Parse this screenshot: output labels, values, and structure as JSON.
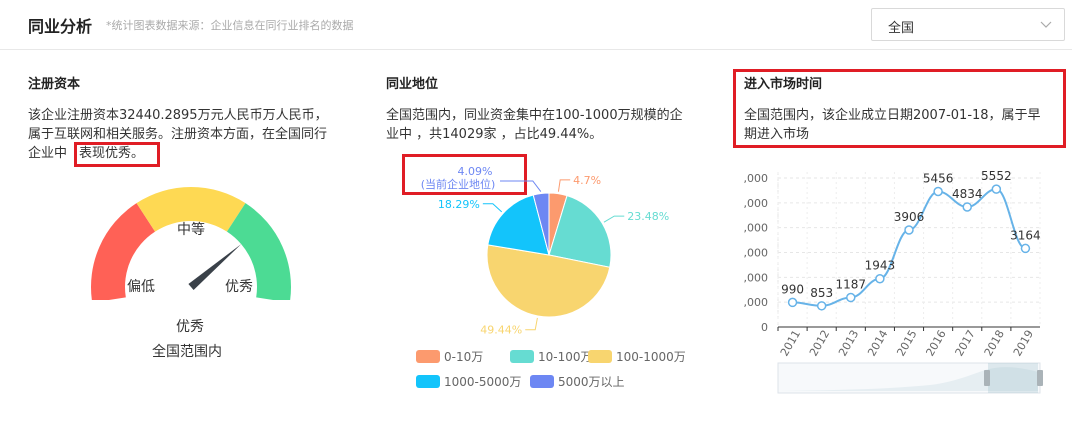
{
  "header": {
    "title": "同业分析",
    "note": "*统计图表数据来源：企业信息在同行业排名的数据",
    "region_select": "全国"
  },
  "registered_capital": {
    "title": "注册资本",
    "text_line1": "该企业注册资本32440.2895万元人民币万人民币，",
    "text_line2": "属于互联网和相关服务。注册资本方面，在全国同行",
    "text_line3_prefix": "企业中",
    "text_highlight": "表现优秀。",
    "gauge": {
      "labels": {
        "low": "偏低",
        "mid": "中等",
        "high": "优秀"
      },
      "colors": {
        "low": "#ff6156",
        "mid": "#fed953",
        "high": "#4cdb94"
      },
      "result": "优秀",
      "scope": "全国范围内",
      "pointer_fraction": 0.75
    }
  },
  "industry_position": {
    "title": "同业地位",
    "text_line1": "全国范围内，同业资金集中在100-1000万规模的企",
    "text_line2": "业中 ，共14029家 ，占比49.44%。",
    "current_label_value": "4.09%",
    "current_label_text": "(当前企业地位)",
    "chart_data": {
      "type": "pie",
      "slices": [
        {
          "name": "0-10万",
          "value": 4.7,
          "label": "4.7%",
          "color": "#fc9a6e"
        },
        {
          "name": "10-100万",
          "value": 23.48,
          "label": "23.48%",
          "color": "#66dcd2"
        },
        {
          "name": "100-1000万",
          "value": 49.44,
          "label": "49.44%",
          "color": "#f8d56f"
        },
        {
          "name": "1000-5000万",
          "value": 18.29,
          "label": "18.29%",
          "color": "#13c4fb"
        },
        {
          "name": "5000万以上",
          "value": 4.09,
          "label": "4.09%",
          "color": "#6d87f3"
        }
      ]
    }
  },
  "market_entry": {
    "title": "进入市场时间",
    "text_line1": "全国范围内，该企业成立日期2007-01-18，属于早",
    "text_line2": "期进入市场",
    "chart_data": {
      "type": "line",
      "x": [
        "2011",
        "2012",
        "2013",
        "2014",
        "2015",
        "2016",
        "2017",
        "2018",
        "2019"
      ],
      "values": [
        990,
        853,
        1187,
        1943,
        3906,
        5456,
        4834,
        5552,
        3164
      ],
      "ylim": [
        0,
        6000
      ],
      "yticks": [
        ",000",
        ",000",
        ",000",
        ",000",
        ",000",
        ",000",
        "0"
      ],
      "color": "#67b3e8"
    }
  }
}
